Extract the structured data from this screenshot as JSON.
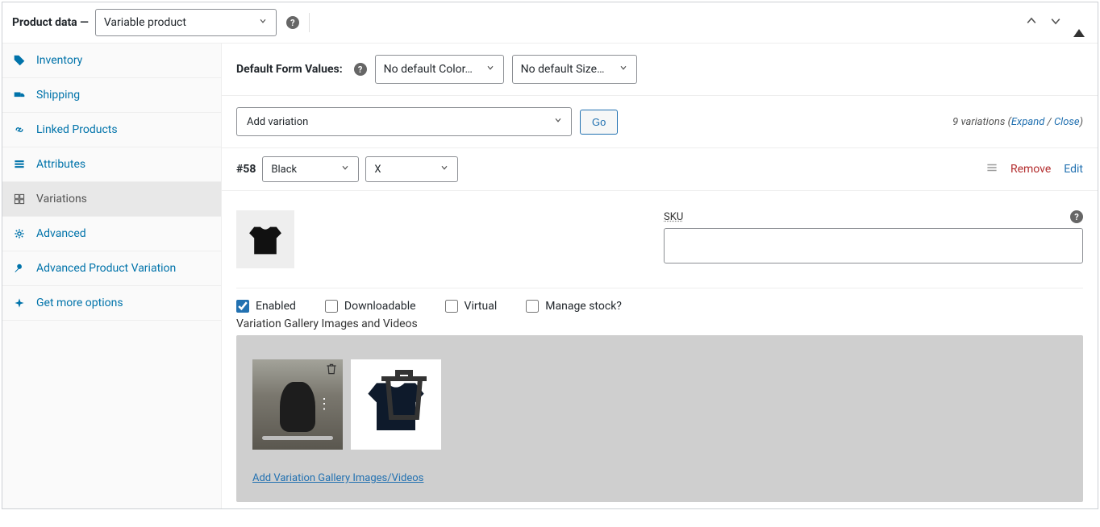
{
  "header": {
    "title": "Product data —",
    "product_type": "Variable product"
  },
  "sidebar": {
    "items": [
      {
        "label": "Inventory"
      },
      {
        "label": "Shipping"
      },
      {
        "label": "Linked Products"
      },
      {
        "label": "Attributes"
      },
      {
        "label": "Variations"
      },
      {
        "label": "Advanced"
      },
      {
        "label": "Advanced Product Variation"
      },
      {
        "label": "Get more options"
      }
    ]
  },
  "defaults": {
    "label": "Default Form Values:",
    "color": "No default Color…",
    "size": "No default Size…"
  },
  "addrow": {
    "select": "Add variation",
    "go": "Go",
    "count_text": "9 variations",
    "expand": "Expand",
    "close": "Close"
  },
  "variation": {
    "id": "#58",
    "attr_color": "Black",
    "attr_size": "X",
    "remove": "Remove",
    "edit": "Edit",
    "sku_label": "SKU",
    "sku_value": "",
    "enabled": "Enabled",
    "downloadable": "Downloadable",
    "virtual": "Virtual",
    "manage_stock": "Manage stock?",
    "gallery_title": "Variation Gallery Images and Videos",
    "gallery_add": "Add Variation Gallery Images/Videos"
  }
}
